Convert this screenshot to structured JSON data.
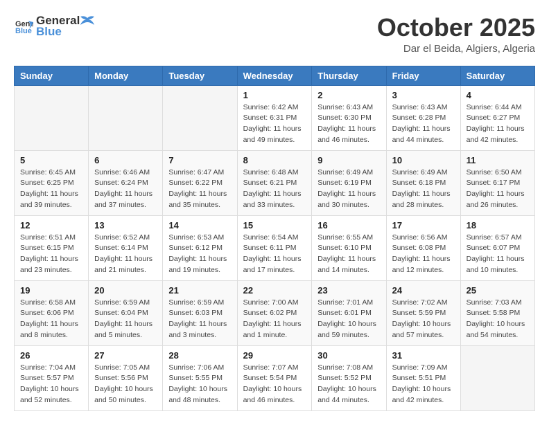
{
  "header": {
    "logo_general": "General",
    "logo_blue": "Blue",
    "title": "October 2025",
    "subtitle": "Dar el Beida, Algiers, Algeria"
  },
  "weekdays": [
    "Sunday",
    "Monday",
    "Tuesday",
    "Wednesday",
    "Thursday",
    "Friday",
    "Saturday"
  ],
  "weeks": [
    [
      {
        "day": "",
        "info": ""
      },
      {
        "day": "",
        "info": ""
      },
      {
        "day": "",
        "info": ""
      },
      {
        "day": "1",
        "info": "Sunrise: 6:42 AM\nSunset: 6:31 PM\nDaylight: 11 hours and 49 minutes."
      },
      {
        "day": "2",
        "info": "Sunrise: 6:43 AM\nSunset: 6:30 PM\nDaylight: 11 hours and 46 minutes."
      },
      {
        "day": "3",
        "info": "Sunrise: 6:43 AM\nSunset: 6:28 PM\nDaylight: 11 hours and 44 minutes."
      },
      {
        "day": "4",
        "info": "Sunrise: 6:44 AM\nSunset: 6:27 PM\nDaylight: 11 hours and 42 minutes."
      }
    ],
    [
      {
        "day": "5",
        "info": "Sunrise: 6:45 AM\nSunset: 6:25 PM\nDaylight: 11 hours and 39 minutes."
      },
      {
        "day": "6",
        "info": "Sunrise: 6:46 AM\nSunset: 6:24 PM\nDaylight: 11 hours and 37 minutes."
      },
      {
        "day": "7",
        "info": "Sunrise: 6:47 AM\nSunset: 6:22 PM\nDaylight: 11 hours and 35 minutes."
      },
      {
        "day": "8",
        "info": "Sunrise: 6:48 AM\nSunset: 6:21 PM\nDaylight: 11 hours and 33 minutes."
      },
      {
        "day": "9",
        "info": "Sunrise: 6:49 AM\nSunset: 6:19 PM\nDaylight: 11 hours and 30 minutes."
      },
      {
        "day": "10",
        "info": "Sunrise: 6:49 AM\nSunset: 6:18 PM\nDaylight: 11 hours and 28 minutes."
      },
      {
        "day": "11",
        "info": "Sunrise: 6:50 AM\nSunset: 6:17 PM\nDaylight: 11 hours and 26 minutes."
      }
    ],
    [
      {
        "day": "12",
        "info": "Sunrise: 6:51 AM\nSunset: 6:15 PM\nDaylight: 11 hours and 23 minutes."
      },
      {
        "day": "13",
        "info": "Sunrise: 6:52 AM\nSunset: 6:14 PM\nDaylight: 11 hours and 21 minutes."
      },
      {
        "day": "14",
        "info": "Sunrise: 6:53 AM\nSunset: 6:12 PM\nDaylight: 11 hours and 19 minutes."
      },
      {
        "day": "15",
        "info": "Sunrise: 6:54 AM\nSunset: 6:11 PM\nDaylight: 11 hours and 17 minutes."
      },
      {
        "day": "16",
        "info": "Sunrise: 6:55 AM\nSunset: 6:10 PM\nDaylight: 11 hours and 14 minutes."
      },
      {
        "day": "17",
        "info": "Sunrise: 6:56 AM\nSunset: 6:08 PM\nDaylight: 11 hours and 12 minutes."
      },
      {
        "day": "18",
        "info": "Sunrise: 6:57 AM\nSunset: 6:07 PM\nDaylight: 11 hours and 10 minutes."
      }
    ],
    [
      {
        "day": "19",
        "info": "Sunrise: 6:58 AM\nSunset: 6:06 PM\nDaylight: 11 hours and 8 minutes."
      },
      {
        "day": "20",
        "info": "Sunrise: 6:59 AM\nSunset: 6:04 PM\nDaylight: 11 hours and 5 minutes."
      },
      {
        "day": "21",
        "info": "Sunrise: 6:59 AM\nSunset: 6:03 PM\nDaylight: 11 hours and 3 minutes."
      },
      {
        "day": "22",
        "info": "Sunrise: 7:00 AM\nSunset: 6:02 PM\nDaylight: 11 hours and 1 minute."
      },
      {
        "day": "23",
        "info": "Sunrise: 7:01 AM\nSunset: 6:01 PM\nDaylight: 10 hours and 59 minutes."
      },
      {
        "day": "24",
        "info": "Sunrise: 7:02 AM\nSunset: 5:59 PM\nDaylight: 10 hours and 57 minutes."
      },
      {
        "day": "25",
        "info": "Sunrise: 7:03 AM\nSunset: 5:58 PM\nDaylight: 10 hours and 54 minutes."
      }
    ],
    [
      {
        "day": "26",
        "info": "Sunrise: 7:04 AM\nSunset: 5:57 PM\nDaylight: 10 hours and 52 minutes."
      },
      {
        "day": "27",
        "info": "Sunrise: 7:05 AM\nSunset: 5:56 PM\nDaylight: 10 hours and 50 minutes."
      },
      {
        "day": "28",
        "info": "Sunrise: 7:06 AM\nSunset: 5:55 PM\nDaylight: 10 hours and 48 minutes."
      },
      {
        "day": "29",
        "info": "Sunrise: 7:07 AM\nSunset: 5:54 PM\nDaylight: 10 hours and 46 minutes."
      },
      {
        "day": "30",
        "info": "Sunrise: 7:08 AM\nSunset: 5:52 PM\nDaylight: 10 hours and 44 minutes."
      },
      {
        "day": "31",
        "info": "Sunrise: 7:09 AM\nSunset: 5:51 PM\nDaylight: 10 hours and 42 minutes."
      },
      {
        "day": "",
        "info": ""
      }
    ]
  ]
}
